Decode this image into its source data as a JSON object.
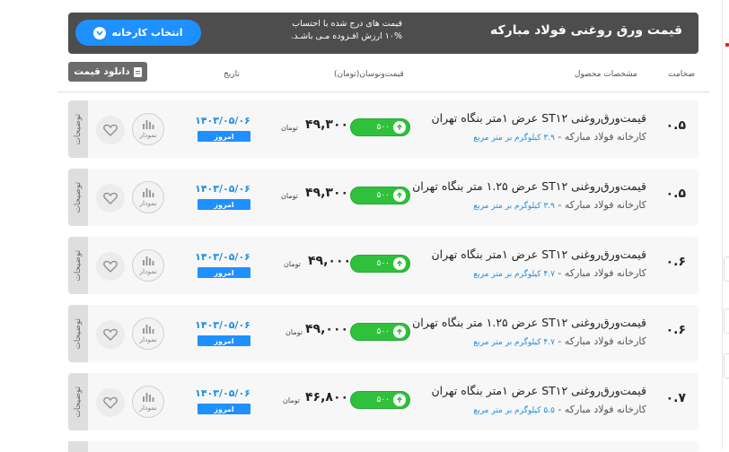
{
  "header": {
    "title": "قیمت ورق روغنی فولاد مبارکه",
    "note_line1": "قیمت های درج شده با احتساب",
    "note_line2": "۱۰% ارزش افـزوده مـی باشـد.",
    "select_factory": "انتخاب کارخانه"
  },
  "toolbar": {
    "download_label": "دانلود قیمت"
  },
  "columns": {
    "thickness": "ضخامت",
    "specs": "مشخصات محصول",
    "price": "قیمت‌ونوسان(تومان)",
    "date": "تاریخ"
  },
  "rows": [
    {
      "title": "قیمت‌ورق‌روغنی ST۱۲ عرض ۱متر بنگاه تهران",
      "producer": "کارخانه فولاد مبارکه -",
      "weight": "۳.۹ کیلوگرم بر متر مربع",
      "thickness": "۰.۵",
      "change": "۵۰۰",
      "price": "۴۹,۳۰۰",
      "unit": "تومان",
      "date": "۱۴۰۳/۰۵/۰۶",
      "today": "امروز",
      "chart_label": "نمودار",
      "desc": "توضیحات"
    },
    {
      "title": "قیمت‌ورق‌روغنی ST۱۲ عرض ۱.۲۵ متر بنگاه تهران",
      "producer": "کارخانه فولاد مبارکه -",
      "weight": "۳.۹ کیلوگرم بر متر مربع",
      "thickness": "۰.۵",
      "change": "۵۰۰",
      "price": "۴۹,۳۰۰",
      "unit": "تومان",
      "date": "۱۴۰۳/۰۵/۰۶",
      "today": "امروز",
      "chart_label": "نمودار",
      "desc": "توضیحات"
    },
    {
      "title": "قیمت‌ورق‌روغنی ST۱۲ عرض ۱متر بنگاه تهران",
      "producer": "کارخانه فولاد مبارکه -",
      "weight": "۴.۷ کیلوگرم بر متر مربع",
      "thickness": "۰.۶",
      "change": "۵۰۰",
      "price": "۴۹,۰۰۰",
      "unit": "تومان",
      "date": "۱۴۰۳/۰۵/۰۶",
      "today": "امروز",
      "chart_label": "نمودار",
      "desc": "توضیحات"
    },
    {
      "title": "قیمت‌ورق‌روغنی ST۱۲ عرض ۱.۲۵ متر بنگاه تهران",
      "producer": "کارخانه فولاد مبارکه -",
      "weight": "۴.۷ کیلوگرم بر متر مربع",
      "thickness": "۰.۶",
      "change": "۵۰۰",
      "price": "۴۹,۰۰۰",
      "unit": "تومان",
      "date": "۱۴۰۳/۰۵/۰۶",
      "today": "امروز",
      "chart_label": "نمودار",
      "desc": "توضیحات"
    },
    {
      "title": "قیمت‌ورق‌روغنی ST۱۲ عرض ۱متر بنگاه تهران",
      "producer": "کارخانه فولاد مبارکه -",
      "weight": "۵.۵ کیلوگرم بر متر مربع",
      "thickness": "۰.۷",
      "change": "۵۰۰",
      "price": "۴۶,۸۰۰",
      "unit": "تومان",
      "date": "۱۴۰۳/۰۵/۰۶",
      "today": "امروز",
      "chart_label": "نمودار",
      "desc": "توضیحات"
    }
  ],
  "colors": {
    "accent": "#1e90ff",
    "up": "#2fc13c",
    "header_bg": "#4d4d4d"
  }
}
